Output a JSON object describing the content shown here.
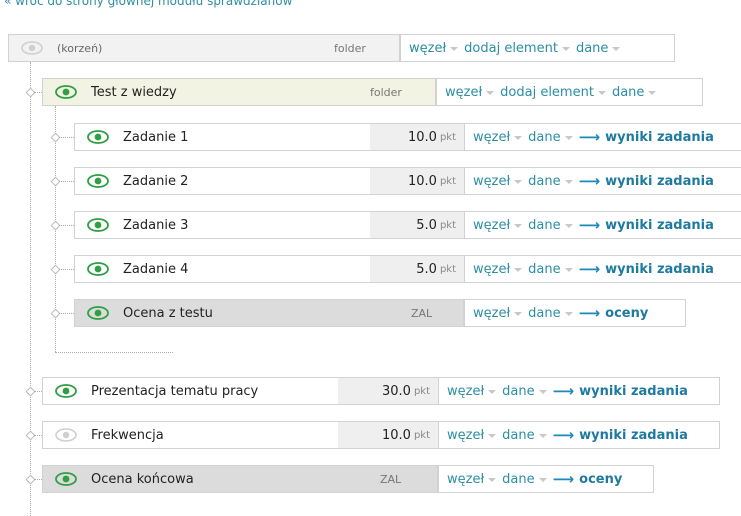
{
  "top_link": "« wróć do strony głównej modułu sprawdzianów",
  "actions": {
    "node": "węzeł",
    "add_element": "dodaj element",
    "data": "dane"
  },
  "rows": [
    {
      "name": "(korzeń)",
      "type": "folder",
      "visible": false
    },
    {
      "name": "Test z wiedzy",
      "type": "folder",
      "visible": true
    },
    {
      "name": "Zadanie 1",
      "score": "10.0",
      "unit": "pkt",
      "link": "wyniki zadania",
      "visible": true
    },
    {
      "name": "Zadanie 2",
      "score": "10.0",
      "unit": "pkt",
      "link": "wyniki zadania",
      "visible": true
    },
    {
      "name": "Zadanie 3",
      "score": "5.0",
      "unit": "pkt",
      "link": "wyniki zadania",
      "visible": true
    },
    {
      "name": "Zadanie 4",
      "score": "5.0",
      "unit": "pkt",
      "link": "wyniki zadania",
      "visible": true
    },
    {
      "name": "Ocena z testu",
      "type": "ZAL",
      "link": "oceny",
      "visible": true
    },
    {
      "name": "Prezentacja tematu pracy",
      "score": "30.0",
      "unit": "pkt",
      "link": "wyniki zadania",
      "visible": true
    },
    {
      "name": "Frekwencja",
      "score": "10.0",
      "unit": "pkt",
      "link": "wyniki zadania",
      "visible": false
    },
    {
      "name": "Ocena końcowa",
      "type": "ZAL",
      "link": "oceny",
      "visible": true
    }
  ],
  "colors": {
    "root_name_bg": "#f2f2f2",
    "folder_name_bg": "#f2f3e3",
    "item_name_bg": "#ffffff",
    "score_bg": "#efefef",
    "grade_bg": "#dcdcdc",
    "eye_visible": "#2ea043",
    "eye_hidden": "#cfcfcf",
    "link": "#1f7aa0"
  }
}
